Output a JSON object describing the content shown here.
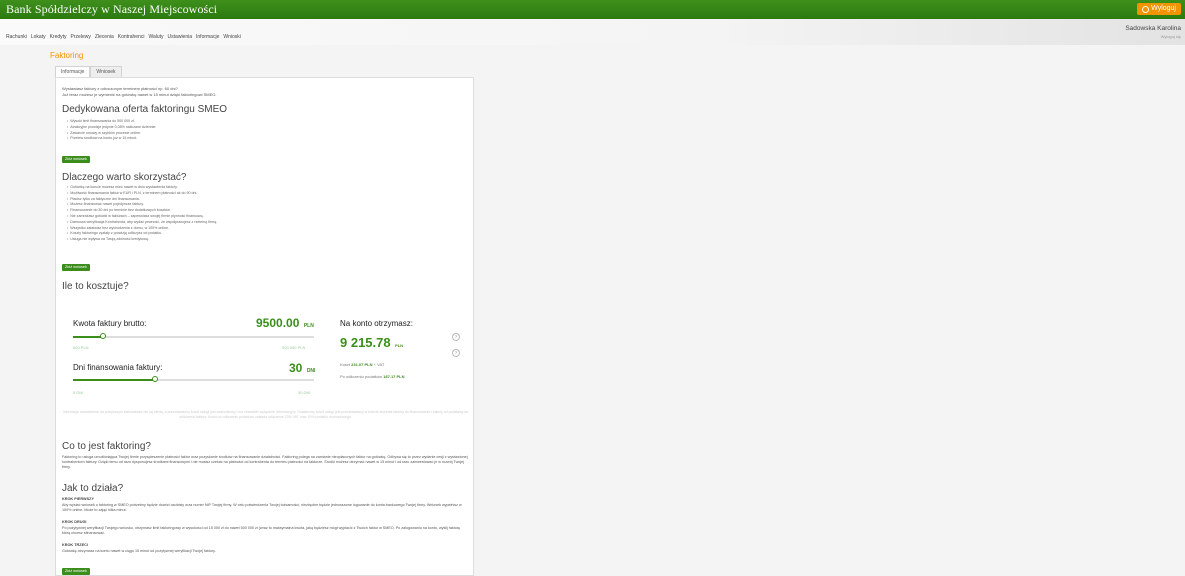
{
  "app": {
    "bank_name": "Bank Spółdzielczy w Naszej Miejscowości",
    "logout": "Wyloguj"
  },
  "menu": [
    "Rachunki",
    "Lokaty",
    "Kredyty",
    "Przelewy",
    "Zlecenia",
    "Kontrahenci",
    "Waluty",
    "Ustawienia",
    "Informacje",
    "Wnioski"
  ],
  "user": {
    "name": "Sadowska Karolina",
    "sub": "Wyloguj się"
  },
  "page": {
    "title": "Faktoring"
  },
  "tabs": [
    "Informacje",
    "Wniosek"
  ],
  "intro": {
    "line1": "Wystawiasz faktury z odroczonym terminem płatności np. 60 dni?",
    "line2": "Już teraz możesz je wymienić na gotówkę nawet w 15 minut dzięki faktoringowi SMEO."
  },
  "offer": {
    "title": "Dedykowana oferta faktoringu SMEO",
    "bullets": [
      "Wysoki limit finansowania do 500 000 zł.",
      "Atrakcyjne prowizje jedynie 0,08% naliczane dziennie.",
      "Zawarcie umowy w szybkim procesie online.",
      "Przelew środków na konto już w 15 minut."
    ],
    "button": "Złóż wniosek"
  },
  "why": {
    "title": "Dlaczego warto skorzystać?",
    "bullets": [
      "Gotówkę na koncie możesz mieć nawet w dniu wystawienia faktury.",
      "Możliwość finansowania faktur w EUR i PLN, z terminem płatności aż do 90 dni.",
      "Płacisz tylko za faktyczne dni finansowania.",
      "Możesz finansować nawet pojedyncze faktury.",
      "Finansowanie do 30 dni po terminie bez dodatkowych kosztów.",
      "Nie zamrażasz gotówki w fakturach – zapewniasz swojej firmie płynność finansową.",
      "Darmowa weryfikacja Kontrahenta, aby wydać pewność, że współpracujesz z rzetelną firmą.",
      "Wszystko załatwisz bez wychodzenia z domu, w 100% online.",
      "Koszty faktoringu zęzłały z prowizją odliczysz od podatku.",
      "Usługa nie wpływa na Twoją zdolność kredytową."
    ],
    "button": "Złóż wniosek"
  },
  "cost": {
    "title": "Ile to kosztuje?",
    "amount_label": "Kwota faktury brutto:",
    "amount_value": "9500.00",
    "amount_unit": "PLN",
    "amount_min": "500 PLN",
    "amount_max": "500 000 PLN",
    "amount_fraction": 0.018,
    "days_label": "Dni finansowania faktury:",
    "days_value": "30",
    "days_unit": "DNI",
    "days_min": "5 DNI",
    "days_max": "30 DNI",
    "days_fraction": 0.34,
    "receive_label": "Na konto otrzymasz:",
    "receive_value": "9 215.78",
    "receive_unit": "PLN",
    "cost_label": "Koszt",
    "cost_value": "231.07 PLN",
    "cost_suffix": "+ VAT",
    "tax_label": "Po odliczeniu podatków",
    "tax_value": "187.17 PLN",
    "note": "Informacje wyświetlane na powyższym kalkulatorze nie są ofertą, a przedstawiony koszt usługi jest szacunkowy i ma charakter wyłącznie informacyjny. Ostateczny koszt usługi jest przedstawiany w trakcie złożenia faktury do finansowania i zależy od podstawy do obliczenia faktury. Koszt po odliczeniu podatków zakłada odliczenie 23% VAT oraz 19% podatku dochodowego."
  },
  "what": {
    "title": "Co to jest faktoring?",
    "text": "Faktoring to usługa umożliwiająca Twojej firmie przyspieszenie płatności faktur oraz pozyskanie środków na finansowanie działalności. Faktoring polega na zamianie nieopłaconych faktur na gotówkę. Odbywa się to przez wydanie cesji z wystawionej kontrahentom faktury. Dzięki temu od razu dysponujesz środkami finansowymi i nie musisz czekać na płatności od kontrahenta do terminu płatności na fakturze. Środki możesz otrzymać nawet w 15 minut i od razu zainwestować je w rozwój Twojej firmy."
  },
  "how": {
    "title": "Jak to działa?",
    "steps": [
      {
        "title": "KROK PIERWSZY",
        "text": "Aby wysłać wniosek o faktoring w SMEO potrzebny będzie dowód osobisty oraz numer NIP Twojej firmy. W celu potwierdzenia Twojej tożsamości, niezbędne będzie jednorazowe logowanie do konta bankowego Twojej firmy. Wniosek wypełnisz w 100% online. Może to zająć kilka minut."
      },
      {
        "title": "KROK DRUGI",
        "text": "Po pozytywnej weryfikacji Twojego wniosku, otrzymasz limit faktoringowy w wysokości od 15 000 zł do nawet 500 000 zł (wraz to maksymalna kwota, jaką będziesz mógł wypłacić z Twoich faktur w SMEO. Po zalogowaniu na konto, wyślij fakturę którą chcesz sfinansować."
      },
      {
        "title": "KROK TRZECI",
        "text": "Gotówkę otrzymasz na konto nawet w ciągu 15 minut od pozytywnej weryfikacji Twojej faktury."
      }
    ],
    "button": "Złóż wniosek"
  },
  "icons": {
    "logout": "power-icon",
    "help": "question-icon"
  },
  "colors": {
    "brand_green": "#3b8e1c",
    "accent_orange": "#f29400"
  }
}
